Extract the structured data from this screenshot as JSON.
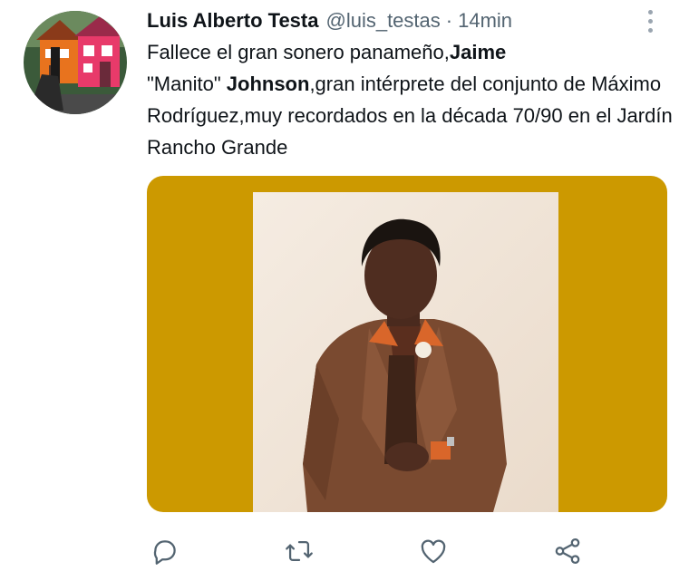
{
  "tweet": {
    "author_name": "Luis Alberto Testa",
    "handle": "@luis_testas",
    "separator": "·",
    "time": "14min",
    "text": {
      "part1": "Fallece el gran sonero panameño,",
      "bold1": "Jaime",
      "part2": "\"Manito\" ",
      "bold2": "Johnson",
      "part3": ",gran intérprete del conjunto de Máximo Rodríguez,muy recordados en la década 70/90 en el Jardín Rancho Grande"
    }
  },
  "icons": {
    "avatar": "house-avatar",
    "more": "more-vertical-icon",
    "reply": "reply-icon",
    "retweet": "retweet-icon",
    "like": "heart-icon",
    "share": "share-icon"
  },
  "colors": {
    "text": "#0f1419",
    "secondary": "#536471",
    "icon": "#536471",
    "media_background": "#cc9900",
    "photo_background": "#f1e6da",
    "suit": "#7a4a30",
    "collar": "#d9662a"
  }
}
